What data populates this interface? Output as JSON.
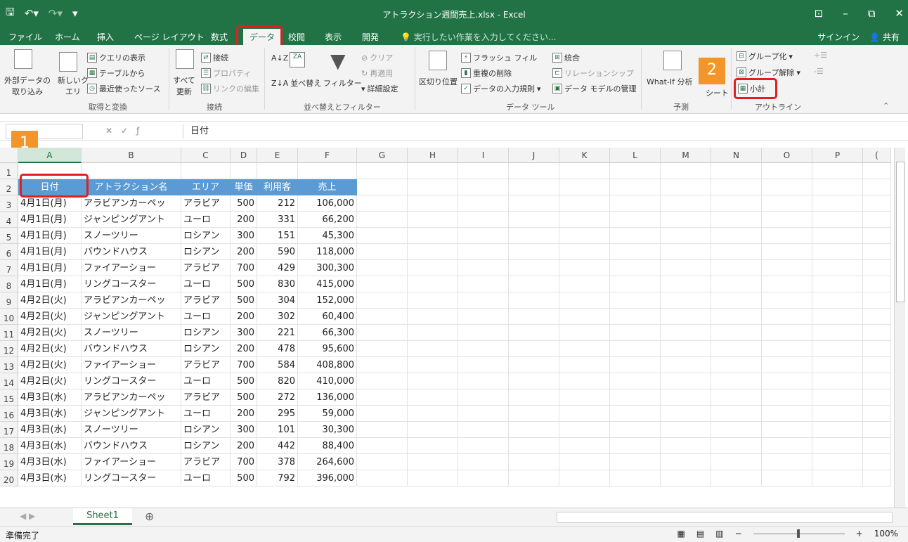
{
  "window": {
    "title": "アトラクション週間売上.xlsx - Excel",
    "qat": {
      "save_icon": "disk-icon",
      "undo_icon": "undo-icon",
      "redo_icon": "redo-icon",
      "custom_icon": "dropdown-icon"
    },
    "controls": [
      "restore-ribbon-icon",
      "minimize-icon",
      "maximize-icon",
      "close-icon"
    ]
  },
  "tabs": {
    "items": [
      "ファイル",
      "ホーム",
      "挿入",
      "ページ レイアウト",
      "数式",
      "データ",
      "校閲",
      "表示",
      "開発"
    ],
    "active": "データ",
    "tell_me": "実行したい作業を入力してください...",
    "sign_in": "サインイン",
    "share": "共有"
  },
  "ribbon": {
    "groups": {
      "get_transform": "取得と変換",
      "connections": "接続",
      "sort_filter": "並べ替えとフィルター",
      "data_tools": "データ ツール",
      "forecast": "予測",
      "outline": "アウトライン"
    },
    "external_data": [
      "外部データの",
      "取り込み"
    ],
    "new_query": [
      "新しいク",
      "エリ"
    ],
    "show_query": "クエリの表示",
    "from_table": "テーブルから",
    "recent_sources": "最近使ったソース",
    "refresh_all": [
      "すべて",
      "更新"
    ],
    "connections_btn": "接続",
    "properties": "プロパティ",
    "edit_links": "リンクの編集",
    "sort": "並べ替え",
    "filter": "フィルター",
    "clear": "クリア",
    "reapply": "再適用",
    "advanced": "詳細設定",
    "text_to_columns": "区切り位置",
    "flash_fill": "フラッシュ フィル",
    "remove_duplicates": "重複の削除",
    "data_validation": "データの入力規則",
    "consolidate": "統合",
    "relationships": "リレーションシップ",
    "data_model": "データ モデルの管理",
    "what_if": "What-If 分析",
    "forecast_sheet": "シート",
    "group": "グループ化",
    "ungroup": "グループ解除",
    "subtotal": "小計"
  },
  "badges": {
    "step1": "1",
    "step2": "2"
  },
  "formula_bar": {
    "name_box": "",
    "content": "日付"
  },
  "sheet": {
    "columns": [
      "A",
      "B",
      "C",
      "D",
      "E",
      "F",
      "G",
      "H",
      "I",
      "J",
      "K",
      "L",
      "M",
      "N",
      "O",
      "P",
      "("
    ],
    "headers": [
      "日付",
      "アトラクション名",
      "エリア",
      "単価",
      "利用客",
      "売上"
    ],
    "rows": [
      [
        "4月1日(月)",
        "アラビアンカーペッ",
        "アラビア",
        "500",
        "212",
        "106,000"
      ],
      [
        "4月1日(月)",
        "ジャンピングアント",
        "ユーロ",
        "200",
        "331",
        "66,200"
      ],
      [
        "4月1日(月)",
        "スノーツリー",
        "ロシアン",
        "300",
        "151",
        "45,300"
      ],
      [
        "4月1日(月)",
        "バウンドハウス",
        "ロシアン",
        "200",
        "590",
        "118,000"
      ],
      [
        "4月1日(月)",
        "ファイアーショー",
        "アラビア",
        "700",
        "429",
        "300,300"
      ],
      [
        "4月1日(月)",
        "リングコースター",
        "ユーロ",
        "500",
        "830",
        "415,000"
      ],
      [
        "4月2日(火)",
        "アラビアンカーペッ",
        "アラビア",
        "500",
        "304",
        "152,000"
      ],
      [
        "4月2日(火)",
        "ジャンピングアント",
        "ユーロ",
        "200",
        "302",
        "60,400"
      ],
      [
        "4月2日(火)",
        "スノーツリー",
        "ロシアン",
        "300",
        "221",
        "66,300"
      ],
      [
        "4月2日(火)",
        "バウンドハウス",
        "ロシアン",
        "200",
        "478",
        "95,600"
      ],
      [
        "4月2日(火)",
        "ファイアーショー",
        "アラビア",
        "700",
        "584",
        "408,800"
      ],
      [
        "4月2日(火)",
        "リングコースター",
        "ユーロ",
        "500",
        "820",
        "410,000"
      ],
      [
        "4月3日(水)",
        "アラビアンカーペッ",
        "アラビア",
        "500",
        "272",
        "136,000"
      ],
      [
        "4月3日(水)",
        "ジャンピングアント",
        "ユーロ",
        "200",
        "295",
        "59,000"
      ],
      [
        "4月3日(水)",
        "スノーツリー",
        "ロシアン",
        "300",
        "101",
        "30,300"
      ],
      [
        "4月3日(水)",
        "バウンドハウス",
        "ロシアン",
        "200",
        "442",
        "88,400"
      ],
      [
        "4月3日(水)",
        "ファイアーショー",
        "アラビア",
        "700",
        "378",
        "264,600"
      ],
      [
        "4月3日(水)",
        "リングコースター",
        "ユーロ",
        "500",
        "792",
        "396,000"
      ]
    ],
    "row_numbers": [
      "1",
      "2",
      "3",
      "4",
      "5",
      "6",
      "7",
      "8",
      "9",
      "10",
      "11",
      "12",
      "13",
      "14",
      "15",
      "16",
      "17",
      "18",
      "19",
      "20"
    ]
  },
  "sheet_tabs": {
    "active": "Sheet1",
    "add": "⊕"
  },
  "status": {
    "ready": "準備完了",
    "zoom": "100%"
  },
  "colors": {
    "excel_green": "#217346",
    "table_header": "#5b9bd5",
    "highlight_red": "#e02020",
    "badge_orange": "#f2962b"
  }
}
